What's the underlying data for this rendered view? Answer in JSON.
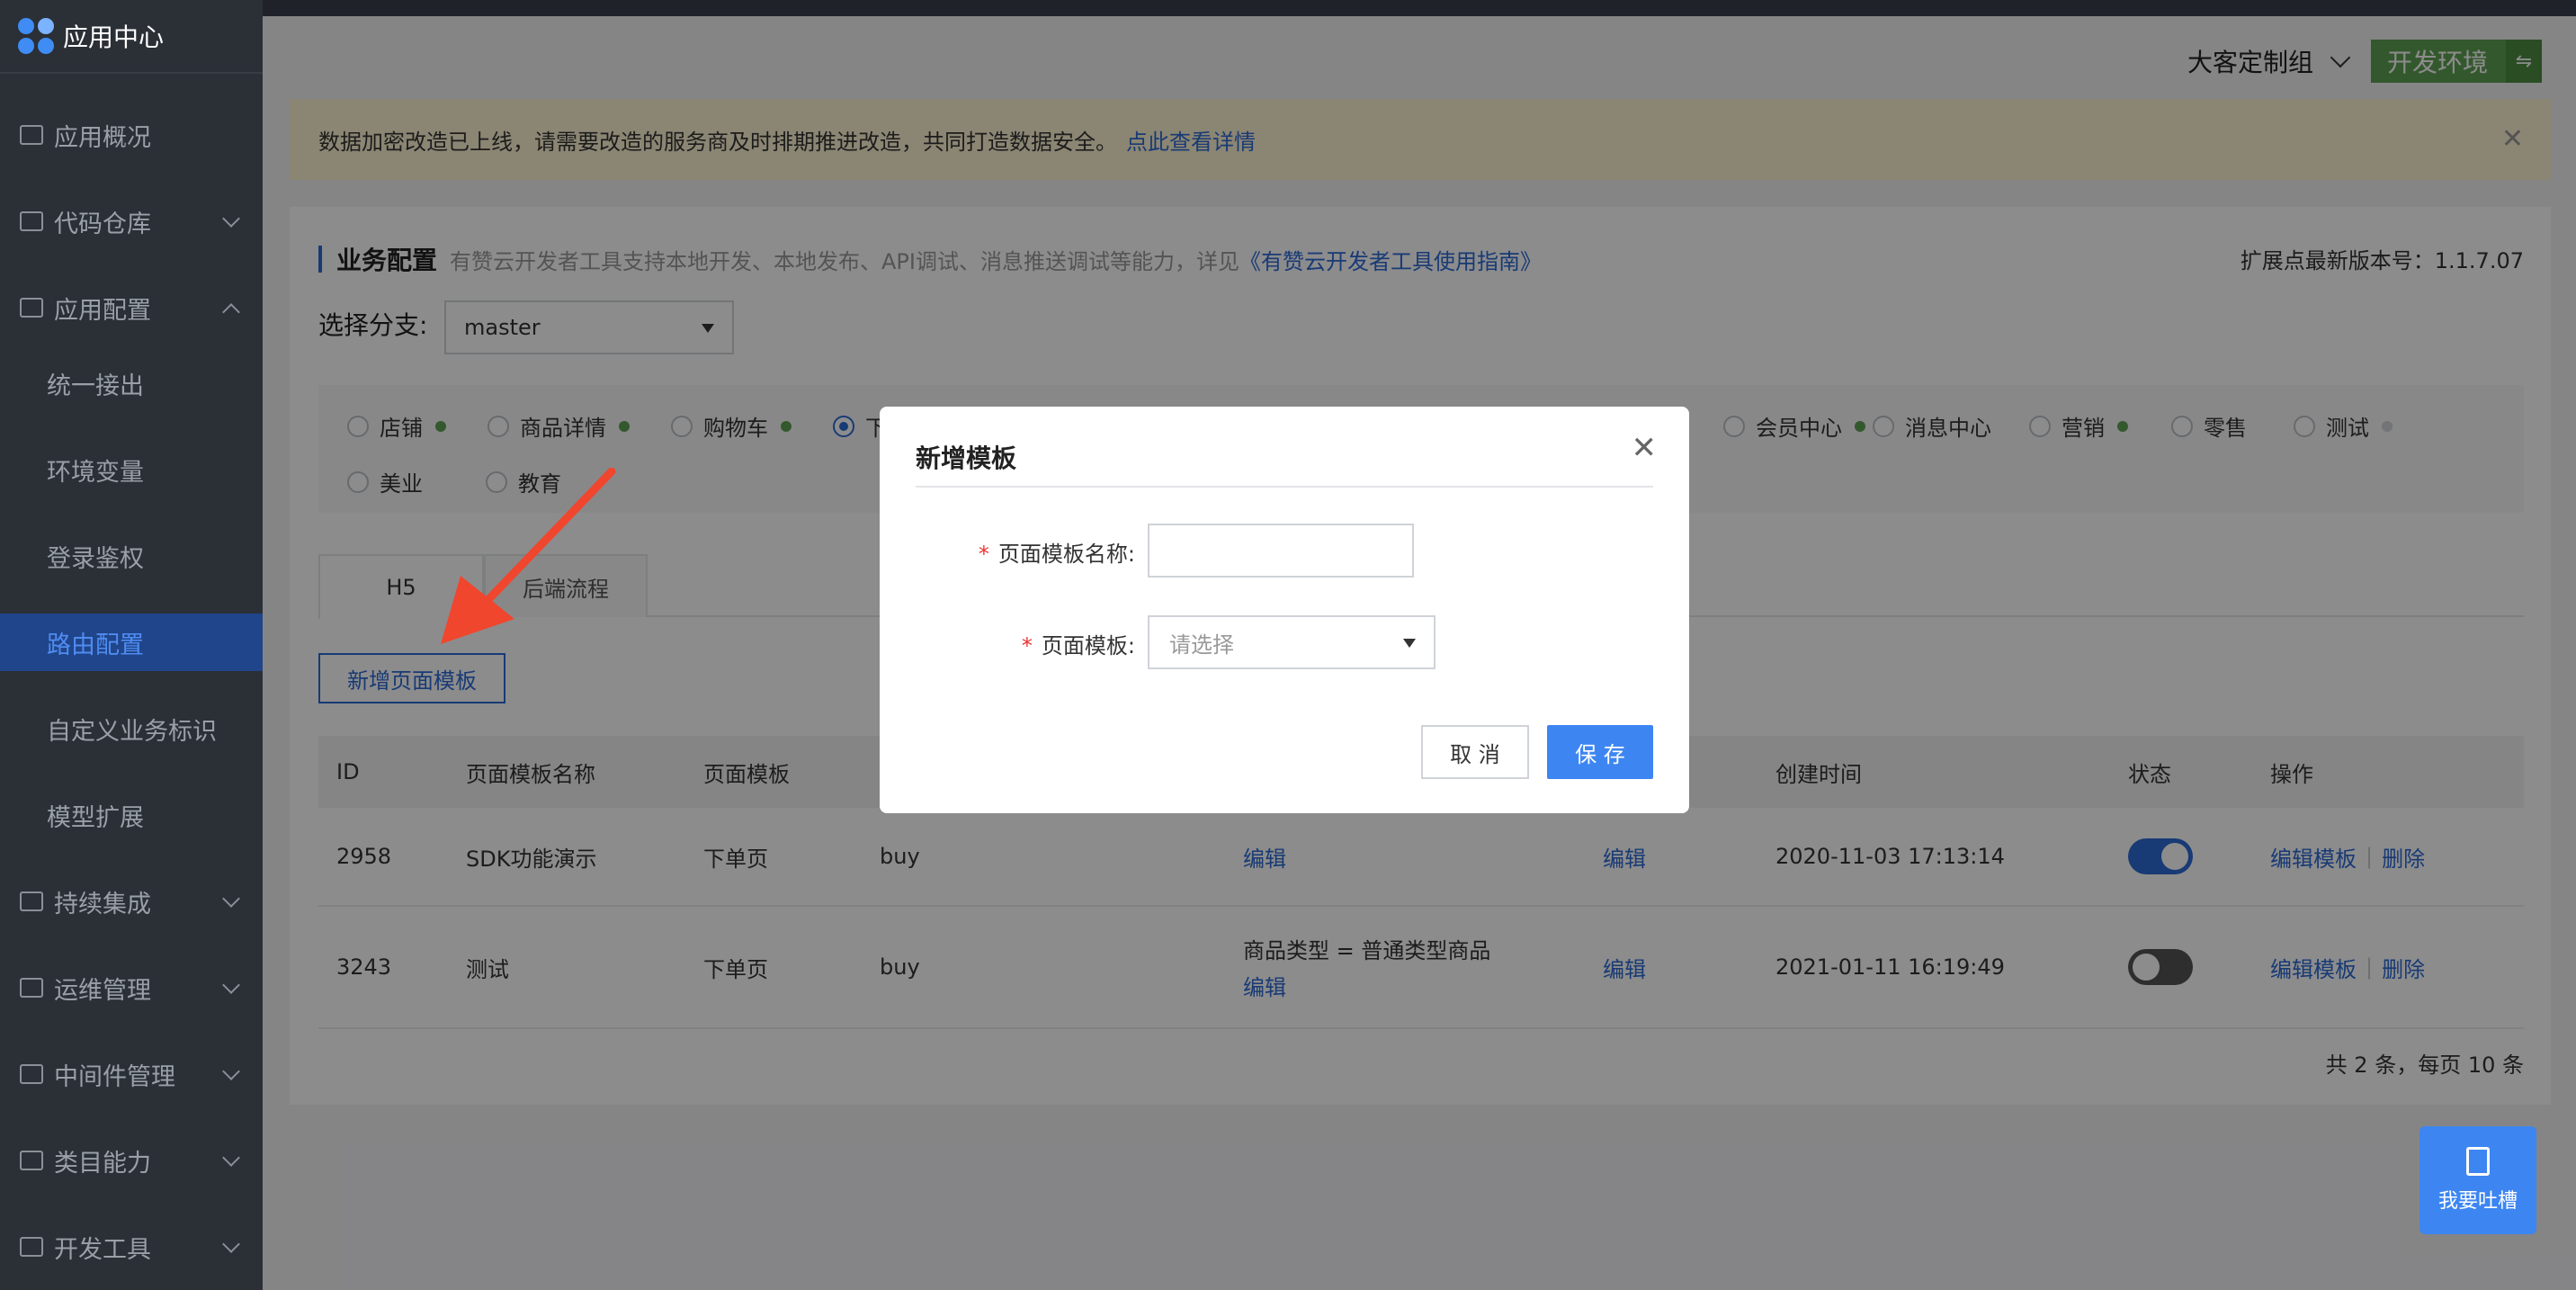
{
  "sidebar": {
    "brand": "应用中心",
    "items": [
      {
        "label": "应用概况",
        "icon": "dashboard-icon"
      },
      {
        "label": "代码仓库",
        "icon": "code-icon"
      },
      {
        "label": "应用配置",
        "icon": "sliders-icon"
      },
      {
        "label": "统一接出"
      },
      {
        "label": "环境变量"
      },
      {
        "label": "登录鉴权"
      },
      {
        "label": "路由配置"
      },
      {
        "label": "自定义业务标识"
      },
      {
        "label": "模型扩展"
      },
      {
        "label": "持续集成",
        "icon": "pipeline-icon"
      },
      {
        "label": "运维管理",
        "icon": "gauge-icon"
      },
      {
        "label": "中间件管理",
        "icon": "server-icon"
      },
      {
        "label": "类目能力",
        "icon": "category-icon"
      },
      {
        "label": "开发工具",
        "icon": "toolbox-icon"
      }
    ]
  },
  "header": {
    "team": "大客定制组",
    "env": "开发环境",
    "env_swap": "⇋"
  },
  "notice": {
    "text": "数据加密改造已上线，请需要改造的服务商及时排期推进改造，共同打造数据安全。",
    "link": "点此查看详情",
    "close": "✕"
  },
  "section": {
    "title": "业务配置",
    "desc": "有赞云开发者工具支持本地开发、本地发布、API调试、消息推送调试等能力，详见",
    "desc_link": "《有赞云开发者工具使用指南》",
    "version": "扩展点最新版本号：1.1.7.07"
  },
  "branch": {
    "label": "选择分支:",
    "value": "master"
  },
  "scopes": [
    {
      "label": "店铺",
      "status": "green"
    },
    {
      "label": "商品详情",
      "status": "green"
    },
    {
      "label": "购物车",
      "status": "green"
    },
    {
      "label": "下",
      "status": "none",
      "selected": true
    },
    {
      "label": "会员中心",
      "status": "green"
    },
    {
      "label": "消息中心",
      "status": "none"
    },
    {
      "label": "营销",
      "status": "green"
    },
    {
      "label": "零售",
      "status": "none"
    },
    {
      "label": "测试",
      "status": "grey"
    },
    {
      "label": "美业",
      "status": "none"
    },
    {
      "label": "教育",
      "status": "none"
    }
  ],
  "tabs": [
    {
      "label": "H5"
    },
    {
      "label": "后端流程"
    }
  ],
  "add_button": "新增页面模板",
  "table": {
    "headers": [
      "ID",
      "页面模板名称",
      "页面模板",
      "创建时间",
      "状态",
      "操作"
    ],
    "rows": [
      {
        "id": "2958",
        "name": "SDK功能演示",
        "template": "下单页",
        "type": "buy",
        "cond": "编辑",
        "cond2": "编辑",
        "created": "2020-11-03 17:13:14",
        "enabled": true,
        "edit": "编辑模板",
        "delete": "删除"
      },
      {
        "id": "3243",
        "name": "测试",
        "template": "下单页",
        "type": "buy",
        "cond_text": "商品类型 = 普通类型商品",
        "cond": "编辑",
        "cond2": "编辑",
        "created": "2021-01-11 16:19:49",
        "enabled": false,
        "edit": "编辑模板",
        "delete": "删除"
      }
    ],
    "pager": "共 2 条，每页 10 条"
  },
  "modal": {
    "title": "新增模板",
    "close": "✕",
    "name_label": "页面模板名称:",
    "template_label": "页面模板:",
    "required_mark": "*",
    "name_value": "",
    "template_placeholder": "请选择",
    "cancel": "取 消",
    "save": "保 存"
  },
  "feedback": "我要吐槽",
  "colors": {
    "primary": "#3d86f2",
    "env_green": "#5fa152",
    "sidebar_bg": "#2b2f36",
    "notice_bg": "#fdf3d1",
    "arrow_red": "#f0462e"
  }
}
